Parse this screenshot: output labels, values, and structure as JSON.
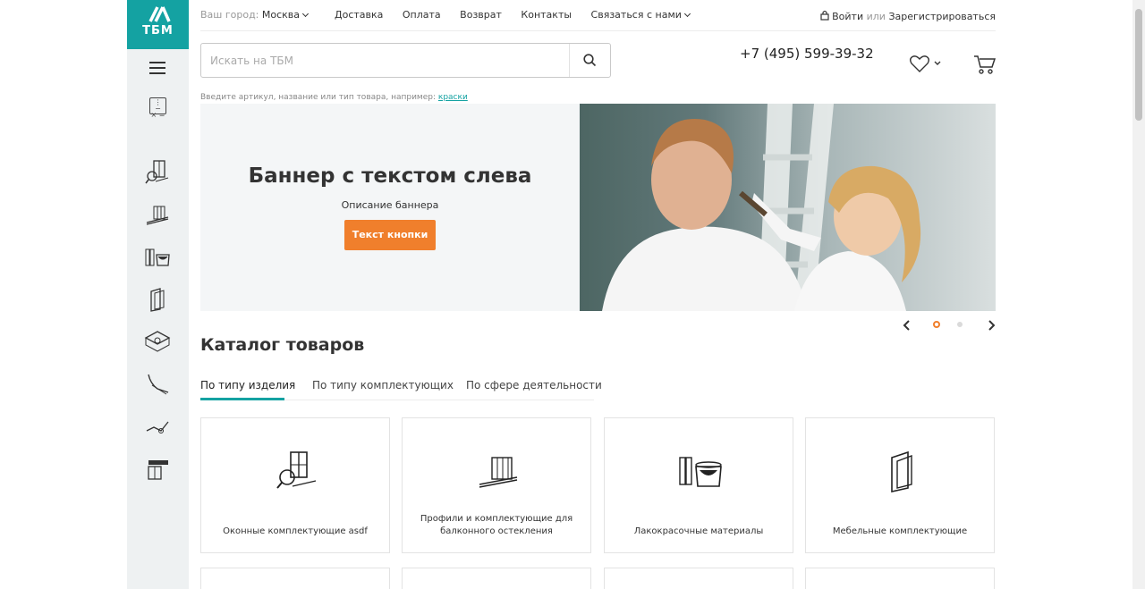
{
  "logo": {
    "text": "ТБМ"
  },
  "header": {
    "city_label": "Ваш город:",
    "city_value": "Москва",
    "nav": [
      "Доставка",
      "Оплата",
      "Возврат",
      "Контакты",
      "Связаться с нами"
    ],
    "login": "Войти",
    "login_or": "или",
    "register": "Зарегистрироваться",
    "phone": "+7 (495) 599-39-32"
  },
  "search": {
    "placeholder": "Искать на ТБМ",
    "hint": "Введите артикул, название или тип товара, например:",
    "hint_link": "краски"
  },
  "sidebar": {
    "icons": [
      "window-fittings-icon",
      "balcony-profile-icon",
      "paint-icon",
      "furniture-fittings-icon",
      "ceiling-icon",
      "gutter-icon",
      "tools-icon",
      "facade-icon"
    ]
  },
  "banner": {
    "title": "Баннер с текстом слева",
    "description": "Описание баннера",
    "button": "Текст кнопки",
    "slide_count": 2,
    "active_slide": 1
  },
  "catalog": {
    "title": "Каталог товаров",
    "tabs": [
      "По типу изделия",
      "По типу комплектующих",
      "По сфере деятельности"
    ],
    "active_tab": 0,
    "cards": [
      {
        "label": "Оконные комплектующие asdf",
        "icon": "window-fittings-icon"
      },
      {
        "label": "Профили и комплектующие для балконного остекления",
        "icon": "balcony-profile-icon"
      },
      {
        "label": "Лакокрасочные материалы",
        "icon": "paint-icon"
      },
      {
        "label": "Мебельные комплектующие",
        "icon": "furniture-fittings-icon"
      }
    ]
  },
  "colors": {
    "brand": "#14a2a2",
    "accent": "#f07f2c"
  }
}
